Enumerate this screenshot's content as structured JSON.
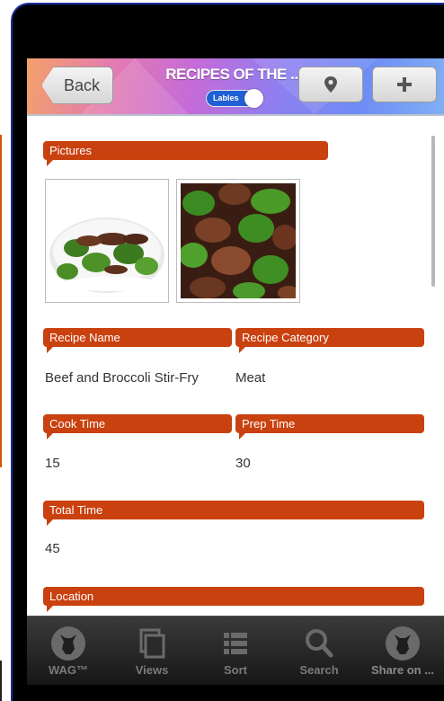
{
  "nav": {
    "back_label": "Back",
    "title": "RECIPES OF THE ...",
    "toggle_label": "Lables"
  },
  "sections": {
    "pictures_label": "Pictures",
    "recipe_name_label": "Recipe Name",
    "recipe_name_value": "Beef and Broccoli Stir-Fry",
    "recipe_category_label": "Recipe Category",
    "recipe_category_value": "Meat",
    "cook_time_label": "Cook Time",
    "cook_time_value": "15",
    "prep_time_label": "Prep Time",
    "prep_time_value": "30",
    "total_time_label": "Total Time",
    "total_time_value": "45",
    "location_label": "Location"
  },
  "tabs": [
    {
      "label": "WAG™",
      "icon": "dog-icon"
    },
    {
      "label": "Views",
      "icon": "views-icon"
    },
    {
      "label": "Sort",
      "icon": "list-icon"
    },
    {
      "label": "Search",
      "icon": "search-icon"
    },
    {
      "label": "Share on ...",
      "icon": "dog-share-icon"
    }
  ],
  "colors": {
    "header_bar": "#c9410f",
    "device_border": "#1a2fa0",
    "toggle": "#1f5fd6"
  }
}
